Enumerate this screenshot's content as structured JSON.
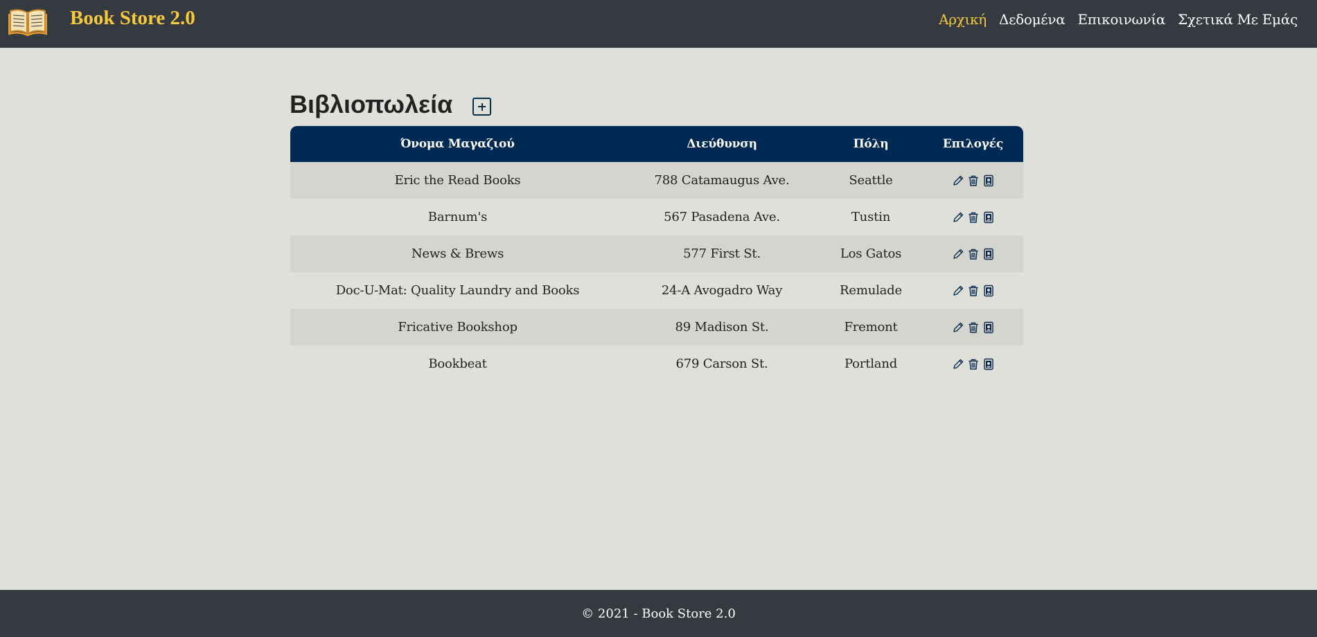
{
  "header": {
    "brand": "Book Store 2.0",
    "logo_icon": "open-book-icon",
    "nav": [
      {
        "label": "Αρχική",
        "active": true
      },
      {
        "label": "Δεδομένα",
        "active": false
      },
      {
        "label": "Επικοινωνία",
        "active": false
      },
      {
        "label": "Σχετικά Με Εμάς",
        "active": false
      }
    ]
  },
  "main": {
    "title": "Βιβλιοπωλεία",
    "add_icon": "plus-square-icon",
    "columns": [
      "Όνομα Μαγαζιού",
      "Διεύθυνση",
      "Πόλη",
      "Επιλογές"
    ],
    "rows": [
      {
        "name": "Eric the Read Books",
        "address": "788 Catamaugus Ave.",
        "city": "Seattle"
      },
      {
        "name": "Barnum's",
        "address": "567 Pasadena Ave.",
        "city": "Tustin"
      },
      {
        "name": "News & Brews",
        "address": "577 First St.",
        "city": "Los Gatos"
      },
      {
        "name": "Doc-U-Mat: Quality Laundry and Books",
        "address": "24-A Avogadro Way",
        "city": "Remulade"
      },
      {
        "name": "Fricative Bookshop",
        "address": "89 Madison St.",
        "city": "Fremont"
      },
      {
        "name": "Bookbeat",
        "address": "679 Carson St.",
        "city": "Portland"
      }
    ],
    "row_actions": [
      "pencil-icon",
      "trash-icon",
      "person-badge-icon"
    ]
  },
  "footer": {
    "text": "© 2021 - Book Store 2.0"
  },
  "colors": {
    "navbar": "#343a40",
    "brand": "#f7c93d",
    "table_header": "#002a54",
    "page_bg": "#dfe0d9",
    "row_alt": "#d4d5cf"
  }
}
